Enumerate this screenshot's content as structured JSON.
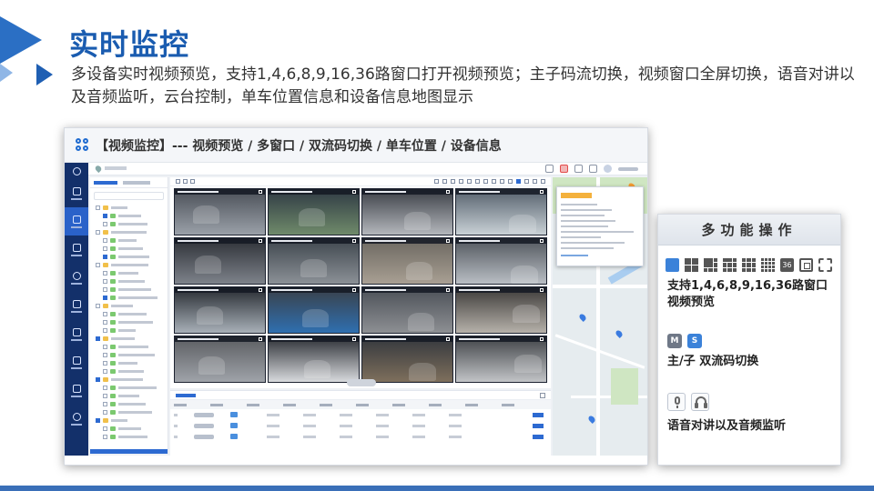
{
  "slide": {
    "title": "实时监控",
    "description": "多设备实时视频预览，支持1,4,6,8,9,16,36路窗口打开视频预览；主子码流切换，视频窗口全屏切换，语音对讲以及音频监听，云台控制，单车位置信息和设备信息地图显示",
    "accent_color": "#1a5cb0"
  },
  "screenshot_card": {
    "title": "【视频监控】--- 视频预览 / 多窗口 / 双流码切换 / 单车位置 / 设备信息",
    "app_icon": "app-logo-icon"
  },
  "feature_panel": {
    "title": "多功能操作",
    "features": [
      {
        "text": "支持1,4,6,8,9,16,36路窗口视频预览",
        "icons": [
          "single-window-icon",
          "four-window-icon",
          "six-window-icon",
          "eight-window-icon",
          "nine-window-icon",
          "sixteen-window-icon",
          "thirty-six-window-icon",
          "fullscreen-icon",
          "exit-fullscreen-icon"
        ]
      },
      {
        "text": "主/子 双流码切换",
        "icons": [
          "main-stream-icon",
          "sub-stream-icon"
        ],
        "labels": [
          "M",
          "S"
        ]
      },
      {
        "text": "语音对讲以及音频监听",
        "icons": [
          "microphone-icon",
          "headset-icon"
        ]
      }
    ],
    "grid_36_label": "36"
  },
  "colors": {
    "nav_bg": "#13306a",
    "primary": "#2d6ad1",
    "footer": "#3a6fb8"
  }
}
